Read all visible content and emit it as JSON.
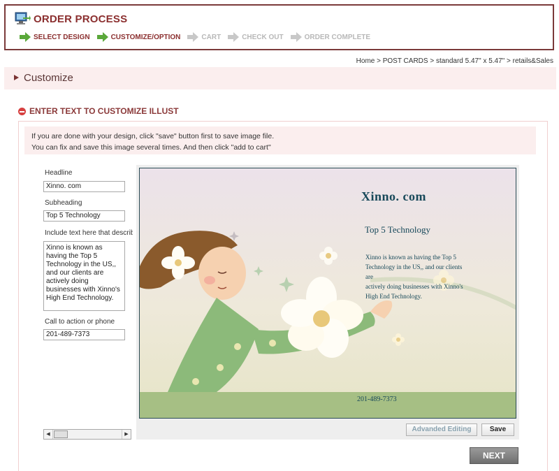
{
  "header": {
    "title": "ORDER PROCESS",
    "steps": [
      {
        "label": "SELECT DESIGN",
        "state": "done"
      },
      {
        "label": "CUSTOMIZE/OPTION",
        "state": "done"
      },
      {
        "label": "CART",
        "state": "pending"
      },
      {
        "label": "CHECK OUT",
        "state": "pending"
      },
      {
        "label": "ORDER COMPLETE",
        "state": "pending"
      }
    ]
  },
  "breadcrumb": "Home > POST CARDS > standard 5.47\" x 5.47\" > retails&Sales",
  "customize_bar": {
    "label": "Customize"
  },
  "section": {
    "title": "ENTER TEXT TO CUSTOMIZE ILLUST"
  },
  "notice": {
    "line1": "If you are done with your design, click \"save\" button first to save image file.",
    "line2": "You can fix and save this image several times. And then click \"add to cart\""
  },
  "form": {
    "headline_label": "Headline",
    "headline_value": "Xinno. com",
    "subheading_label": "Subheading",
    "subheading_value": "Top 5 Technology",
    "body_label": "Include text here that describes",
    "body_value": "Xinno is known as having the Top 5 Technology in the US,, and our clients are actively doing businesses with Xinno's High End Technology.",
    "cta_label": "Call to action or phone",
    "cta_value": "201-489-7373"
  },
  "card": {
    "headline": "Xinno. com",
    "subheading": "Top 5 Technology",
    "body": "Xinno is known as having the Top 5\nTechnology in the US,, and our clients\nare\nactively doing businesses with Xinno's\nHigh End Technology.",
    "phone": "201-489-7373"
  },
  "buttons": {
    "advanced": "Advanded Editing",
    "save": "Save",
    "next": "NEXT"
  },
  "colors": {
    "accent": "#8b2f2f",
    "step_done_arrow": "#5aa83a",
    "step_pending_arrow": "#c8c8c8",
    "card_text": "#18495a"
  },
  "icons": {
    "order": "computer-cart-icon",
    "step_arrow": "arrow-right-icon",
    "customize": "triangle-right-icon",
    "section": "minus-circle-icon"
  }
}
